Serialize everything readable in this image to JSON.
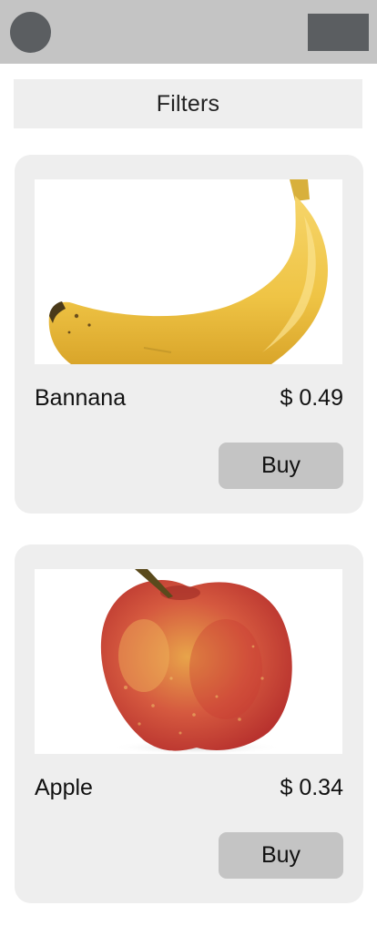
{
  "header": {
    "avatar_icon": "user-avatar-placeholder",
    "menu_icon": "menu-placeholder",
    "colors": {
      "bar": "#c4c4c4",
      "placeholder": "#5b5e61"
    }
  },
  "filters": {
    "label": "Filters"
  },
  "products": [
    {
      "name": "Bannana",
      "price": "$ 0.49",
      "buy_label": "Buy",
      "image": "banana-image"
    },
    {
      "name": "Apple",
      "price": "$ 0.34",
      "buy_label": "Buy",
      "image": "apple-image"
    }
  ],
  "colors": {
    "card": "#eeeeee",
    "button": "#c4c4c4"
  }
}
